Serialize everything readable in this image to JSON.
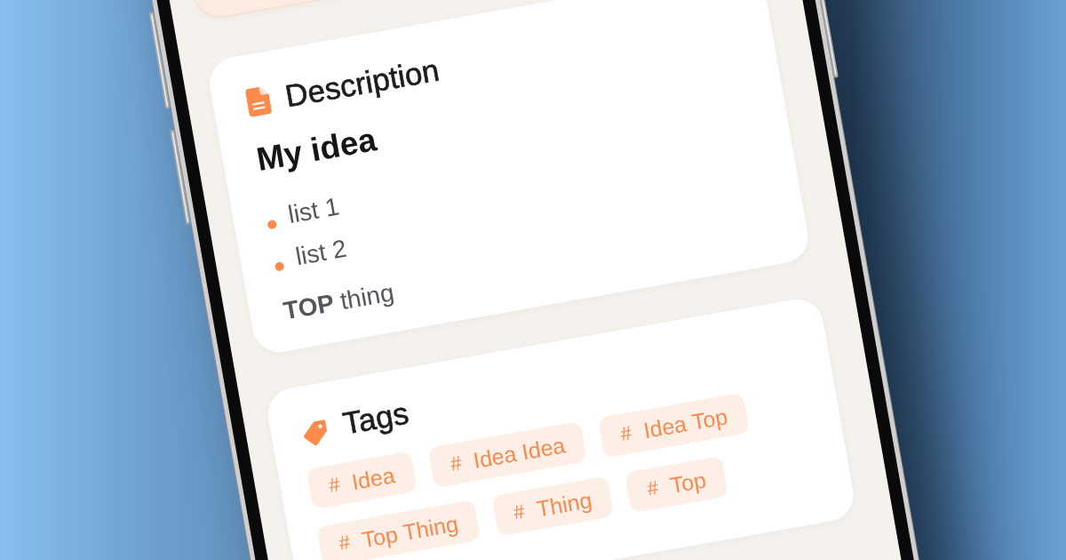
{
  "description": {
    "title": "Description",
    "heading": "My idea",
    "list": [
      "list 1",
      "list 2"
    ],
    "paragraph": "**TOP** thing"
  },
  "tags": {
    "title": "Tags",
    "items": [
      {
        "symbol": "#",
        "label": "Idea"
      },
      {
        "symbol": "#",
        "label": "Idea Idea"
      },
      {
        "symbol": "#",
        "label": "Idea Top"
      },
      {
        "symbol": "#",
        "label": "Top Thing"
      },
      {
        "symbol": "#",
        "label": "Thing"
      },
      {
        "symbol": "#",
        "label": "Top"
      }
    ]
  }
}
